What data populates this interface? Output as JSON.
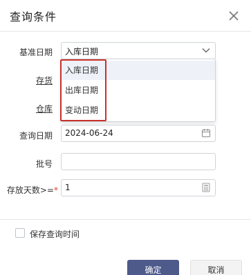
{
  "dialog": {
    "title": "查询条件",
    "close_icon": "close-icon"
  },
  "form": {
    "base_date": {
      "label": "基准日期",
      "value": "入库日期"
    },
    "inventory": {
      "label": "存货"
    },
    "warehouse": {
      "label": "仓库"
    },
    "query_date": {
      "label": "查询日期",
      "value": "2024-06-24"
    },
    "batch": {
      "label": "批号",
      "value": ""
    },
    "storage_days": {
      "label": "存放天数>=",
      "required_mark": "*",
      "value": "1"
    }
  },
  "dropdown": {
    "options": [
      "入库日期",
      "出库日期",
      "变动日期"
    ],
    "selected_index": 0
  },
  "save_time": {
    "label": "保存查询时间",
    "checked": false
  },
  "buttons": {
    "ok": "确定",
    "cancel": "取消"
  },
  "colors": {
    "primary": "#4d5a8a",
    "highlight": "#c8312a",
    "required": "#e53935"
  }
}
